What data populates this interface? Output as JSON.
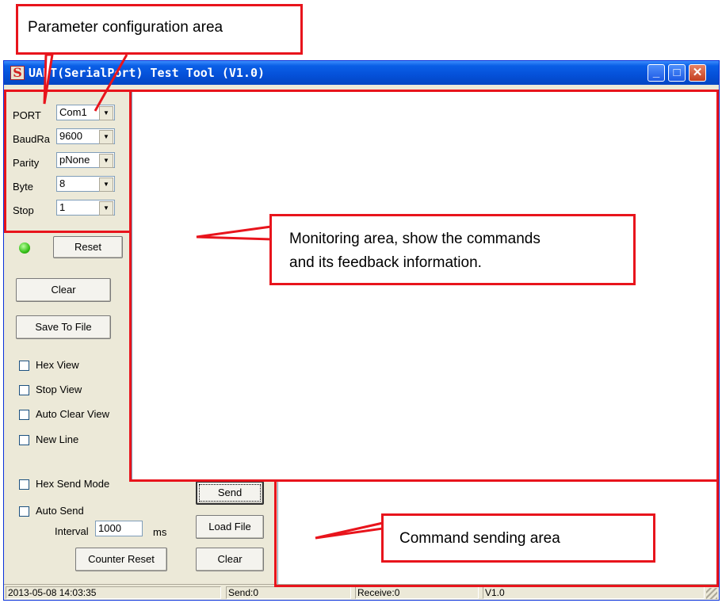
{
  "window": {
    "title": "UART(SerialPort) Test Tool (V1.0)",
    "icon_letter": "S"
  },
  "title_buttons": {
    "minimize_glyph": "_",
    "maximize_glyph": "□",
    "close_glyph": "✕"
  },
  "config": {
    "port_label": "PORT",
    "port_value": "Com1",
    "baud_label": "BaudRa",
    "baud_value": "9600",
    "parity_label": "Parity",
    "parity_value": "pNone",
    "byte_label": "Byte",
    "byte_value": "8",
    "stop_label": "Stop",
    "stop_value": "1"
  },
  "buttons": {
    "reset": "Reset",
    "clear_view": "Clear",
    "save_to_file": "Save To File",
    "send": "Send",
    "load_file": "Load File",
    "clear_send": "Clear",
    "counter_reset": "Counter Reset"
  },
  "options": {
    "hex_view": "Hex View",
    "stop_view": "Stop View",
    "auto_clear_view": "Auto Clear View",
    "new_line": "New Line",
    "hex_send_mode": "Hex Send Mode",
    "auto_send": "Auto Send"
  },
  "interval": {
    "label": "Interval",
    "value": "1000",
    "unit": "ms"
  },
  "status": {
    "datetime": "2013-05-08 14:03:35",
    "send": "Send:0",
    "receive": "Receive:0",
    "version": "V1.0"
  },
  "annotations": {
    "param": "Parameter configuration area",
    "monitor_line1": "Monitoring area, show the commands",
    "monitor_line2": "and its feedback information.",
    "command": "Command sending area"
  },
  "colors": {
    "annotation_red": "#e8141c",
    "titlebar_blue": "#0550d8",
    "window_bg": "#ece9d8",
    "led_green": "#35c018"
  },
  "icons": {
    "dropdown": "dropdown-arrow-icon",
    "led": "status-led-icon",
    "app": "app-logo-icon"
  }
}
